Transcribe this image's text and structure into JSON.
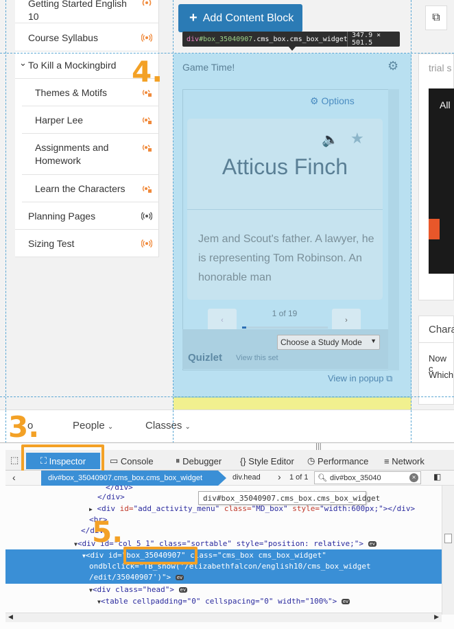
{
  "sidebar": {
    "items": [
      {
        "label": "Getting Started English 10",
        "color": "#f08a3c"
      },
      {
        "label": "Course Syllabus",
        "color": "#f08a3c"
      },
      {
        "label": "To Kill a Mockingbird"
      },
      {
        "label": "Themes & Motifs",
        "color": "#f08a3c"
      },
      {
        "label": "Harper Lee",
        "color": "#f08a3c"
      },
      {
        "label": "Assignments and Homework",
        "color": "#f08a3c"
      },
      {
        "label": "Learn the Characters",
        "color": "#f08a3c"
      },
      {
        "label": "Planning Pages",
        "color": "#555555"
      },
      {
        "label": "Sizing Test",
        "color": "#f08a3c"
      }
    ]
  },
  "toolbar": {
    "add_content_label": "Add Content Block"
  },
  "highlight": {
    "tag": "div",
    "id": "#box_35040907",
    "classes": ".cms_box.cms_box_widget",
    "dims": "347.9 × 501.5"
  },
  "widget": {
    "title": "Game Time!",
    "options_label": "Options",
    "term": "Atticus Finch",
    "definition": "Jem and Scout's father. A lawyer, he is representing Tom Robinson. An honorable man",
    "progress": "1 of 19",
    "progress_fraction": 0.05,
    "study_mode": "Choose a Study Mode",
    "brand": "Quizlet",
    "view_set": "View this set",
    "popup_link": "View in popup"
  },
  "right_panel": {
    "title_top": "trial s",
    "title_mid": "Chara",
    "text1": "Now c",
    "text2": "Which",
    "img_text": "All"
  },
  "annotations": {
    "step3": "3.",
    "step4": "4.",
    "step5": "5."
  },
  "nav": {
    "item_cut": "o",
    "people": "People",
    "classes": "Classes"
  },
  "devtools": {
    "tabs": [
      "Inspector",
      "Console",
      "Debugger",
      "Style Editor",
      "Performance",
      "Network"
    ],
    "breadcrumb": [
      "div#box_35040907.cms_box.cms_box_widget",
      "div.head"
    ],
    "search_count": "1 of 1",
    "search_value": "div#box_35040",
    "tooltip": "div#box_35040907.cms_box.cms_box_widget",
    "lines": {
      "l1": "</div>",
      "l2": "</div>",
      "l3a": "<div ",
      "l3b": "id=",
      "l3c": "\"add_activity_menu\"",
      "l3d": " class=",
      "l3e": "\"MD_box\"",
      "l3f": " style=",
      "l3g": "\"width:600px;\"",
      "l3h": "></div>",
      "l4": "<br>",
      "l5": "</div>",
      "l6a": "<div id=\"col_5_1\" class=\"sortable\" style=\"position: relative;\">",
      "l7a": "<div id=\"box_35040907\" class=\"cms_box cms_box_widget\"",
      "l8": "ondblclick=\"TB_show('/elizabethfalcon/english10/cms_box_widget",
      "l9": "/edit/35040907')\">",
      "l10": "<div class=\"head\">",
      "l11": "<table cellpadding=\"0\" cellspacing=\"0\" width=\"100%\">",
      "ev": "ev"
    }
  }
}
